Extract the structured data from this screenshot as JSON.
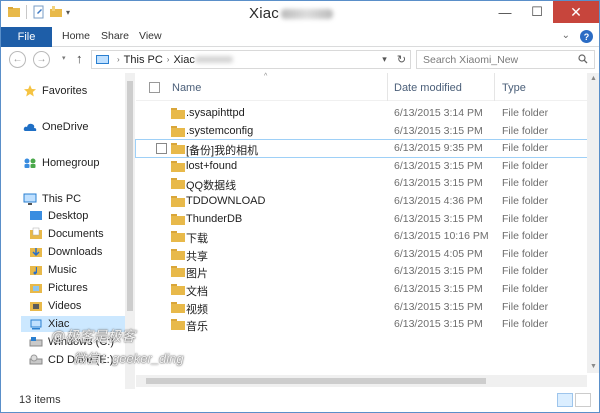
{
  "window": {
    "title": "Xiac",
    "minimize": "—",
    "maximize": "☐",
    "close": "✕"
  },
  "ribbon": {
    "tabs": [
      "File",
      "Home",
      "Share",
      "View"
    ],
    "expand": "⌄",
    "help": "?"
  },
  "address": {
    "back": "←",
    "forward": "→",
    "up": "↑",
    "crumbs": [
      "This PC",
      "Xiac"
    ],
    "refresh": "↻",
    "search_placeholder": "Search Xiaomi_New"
  },
  "nav": {
    "items": [
      {
        "label": "Favorites",
        "icon": "star-icon"
      },
      {
        "label": "OneDrive",
        "icon": "cloud-icon"
      },
      {
        "label": "Homegroup",
        "icon": "homegroup-icon"
      },
      {
        "label": "This PC",
        "icon": "pc-icon"
      },
      {
        "label": "Desktop",
        "icon": "desktop-icon"
      },
      {
        "label": "Documents",
        "icon": "documents-icon"
      },
      {
        "label": "Downloads",
        "icon": "downloads-icon"
      },
      {
        "label": "Music",
        "icon": "music-icon"
      },
      {
        "label": "Pictures",
        "icon": "pictures-icon"
      },
      {
        "label": "Videos",
        "icon": "videos-icon"
      },
      {
        "label": "Xiac",
        "icon": "device-icon"
      },
      {
        "label": "Windows (C:)",
        "icon": "drive-icon"
      },
      {
        "label": "CD Drive (E:)",
        "icon": "cd-drive-icon"
      }
    ]
  },
  "columns": {
    "name": "Name",
    "date": "Date modified",
    "type": "Type"
  },
  "files": [
    {
      "name": ".sysapihttpd",
      "date": "6/13/2015 3:14 PM",
      "type": "File folder"
    },
    {
      "name": ".systemconfig",
      "date": "6/13/2015 3:15 PM",
      "type": "File folder"
    },
    {
      "name": "[备份]我的相机",
      "date": "6/13/2015 9:35 PM",
      "type": "File folder"
    },
    {
      "name": "lost+found",
      "date": "6/13/2015 3:15 PM",
      "type": "File folder"
    },
    {
      "name": "QQ数据线",
      "date": "6/13/2015 3:15 PM",
      "type": "File folder"
    },
    {
      "name": "TDDOWNLOAD",
      "date": "6/13/2015 4:36 PM",
      "type": "File folder"
    },
    {
      "name": "ThunderDB",
      "date": "6/13/2015 3:15 PM",
      "type": "File folder"
    },
    {
      "name": "下载",
      "date": "6/13/2015 10:16 PM",
      "type": "File folder"
    },
    {
      "name": "共享",
      "date": "6/13/2015 4:05 PM",
      "type": "File folder"
    },
    {
      "name": "图片",
      "date": "6/13/2015 3:15 PM",
      "type": "File folder"
    },
    {
      "name": "文档",
      "date": "6/13/2015 3:15 PM",
      "type": "File folder"
    },
    {
      "name": "视频",
      "date": "6/13/2015 3:15 PM",
      "type": "File folder"
    },
    {
      "name": "音乐",
      "date": "6/13/2015 3:15 PM",
      "type": "File folder"
    }
  ],
  "status": {
    "count": "13 items"
  },
  "watermark": {
    "line1": "@极客是极客",
    "line2": "微信：geeker_ding"
  },
  "colors": {
    "accent": "#1e5ea8",
    "close": "#c7453c",
    "folder": "#e8b94a",
    "selection": "#cce8ff"
  }
}
